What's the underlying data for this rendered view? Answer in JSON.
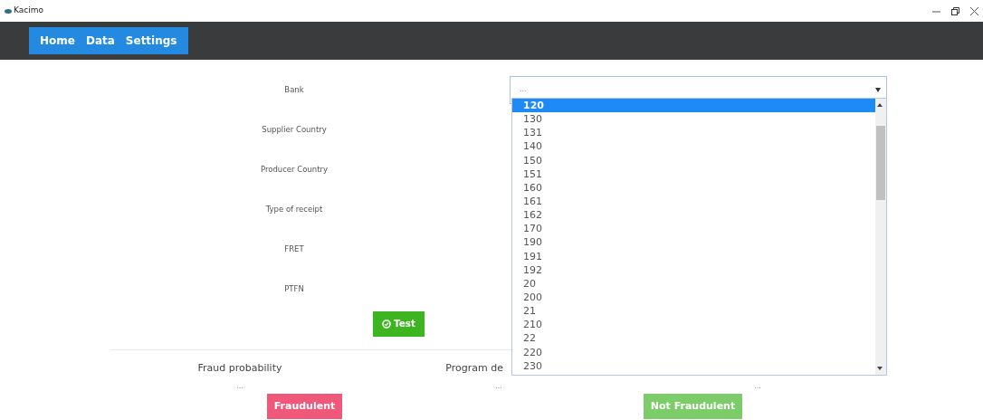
{
  "window": {
    "title": "Kacimo"
  },
  "nav": [
    {
      "label": "Home"
    },
    {
      "label": "Data"
    },
    {
      "label": "Settings"
    }
  ],
  "form": {
    "fields": [
      {
        "label": "Bank",
        "select": {
          "value": "...",
          "expanded": true,
          "options": [
            {
              "label": "120",
              "selected": true
            },
            {
              "label": "130",
              "selected": false
            },
            {
              "label": "131",
              "selected": false
            },
            {
              "label": "140",
              "selected": false
            },
            {
              "label": "150",
              "selected": false
            },
            {
              "label": "151",
              "selected": false
            },
            {
              "label": "160",
              "selected": false
            },
            {
              "label": "161",
              "selected": false
            },
            {
              "label": "162",
              "selected": false
            },
            {
              "label": "170",
              "selected": false
            },
            {
              "label": "190",
              "selected": false
            },
            {
              "label": "191",
              "selected": false
            },
            {
              "label": "192",
              "selected": false
            },
            {
              "label": "20",
              "selected": false
            },
            {
              "label": "200",
              "selected": false
            },
            {
              "label": "21",
              "selected": false
            },
            {
              "label": "210",
              "selected": false
            },
            {
              "label": "22",
              "selected": false
            },
            {
              "label": "220",
              "selected": false
            },
            {
              "label": "230",
              "selected": false
            }
          ]
        }
      },
      {
        "label": "Supplier Country"
      },
      {
        "label": "Producer Country"
      },
      {
        "label": "Type of receipt"
      },
      {
        "label": "FRET"
      },
      {
        "label": "PTFN"
      }
    ],
    "test_button": "Test"
  },
  "results": {
    "labels": [
      "Fraud probability",
      "Program de"
    ],
    "values": [
      "...",
      "...",
      "..."
    ],
    "buttons": [
      {
        "label": "Fraudulent",
        "kind": "fraud"
      },
      {
        "label": "Not Fraudulent",
        "kind": "ok"
      }
    ]
  }
}
